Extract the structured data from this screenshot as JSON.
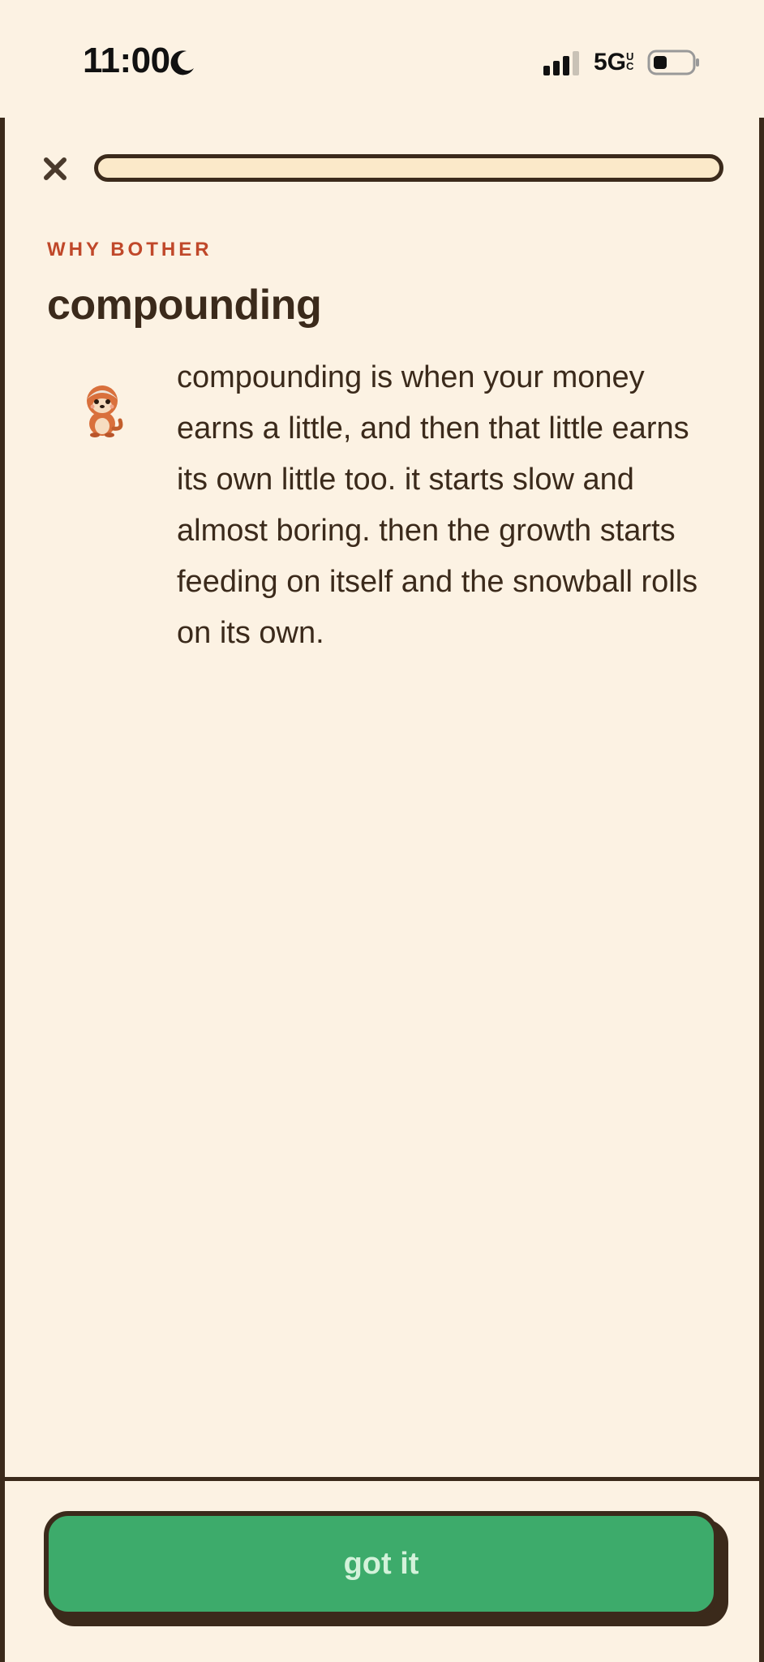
{
  "status_bar": {
    "time": "11:00",
    "network": "5G",
    "network_suffix": "UC",
    "icons": [
      "moon-icon",
      "signal-icon",
      "battery-icon"
    ]
  },
  "lesson": {
    "progress_percent": 0,
    "eyebrow": "WHY BOTHER",
    "title": "compounding",
    "body": "compounding is when your money earns a little, and then that little earns its own little too. it starts slow and almost boring. then the growth starts feeding on itself and the snowball rolls on its own.",
    "mascot_icon": "otter-mascot-icon"
  },
  "actions": {
    "primary_label": "got it"
  },
  "colors": {
    "background": "#fcf2e3",
    "border": "#3b2a1b",
    "accent": "#c0482a",
    "button": "#3dab6b",
    "button_text": "#d3f2da",
    "progress_track": "#fbe9c9"
  }
}
